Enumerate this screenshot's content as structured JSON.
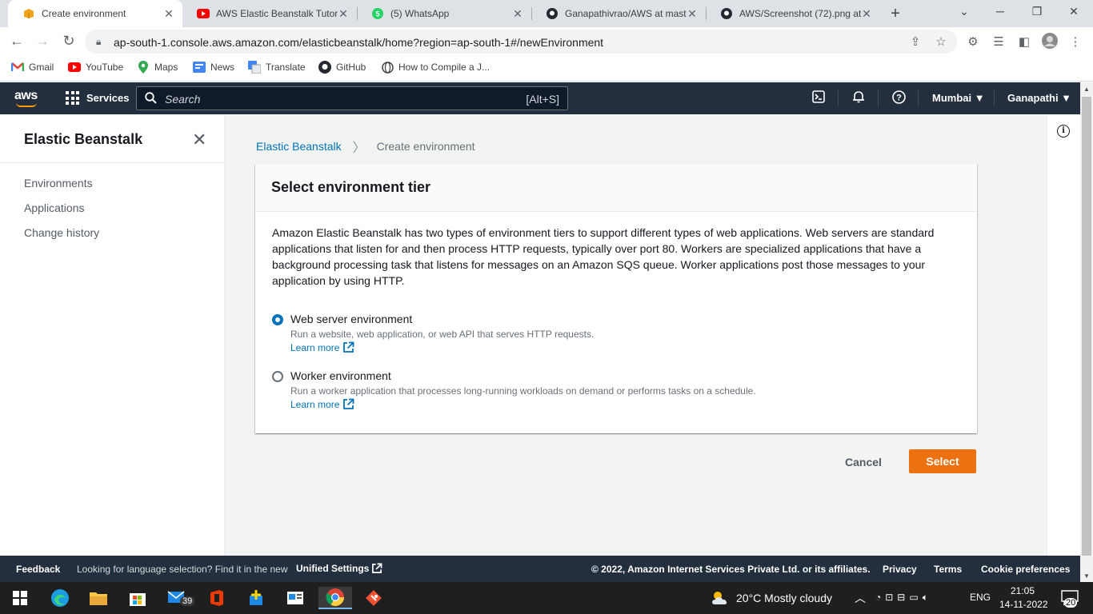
{
  "browser": {
    "tabs": [
      {
        "title": "Create environment",
        "icon": "aws-box-icon",
        "active": true
      },
      {
        "title": "AWS Elastic Beanstalk Tutoria",
        "icon": "youtube-icon"
      },
      {
        "title": "(5) WhatsApp",
        "icon": "whatsapp-icon"
      },
      {
        "title": "Ganapathivrao/AWS at maste",
        "icon": "github-icon"
      },
      {
        "title": "AWS/Screenshot (72).png at",
        "icon": "github-icon"
      }
    ],
    "url": "ap-south-1.console.aws.amazon.com/elasticbeanstalk/home?region=ap-south-1#/newEnvironment",
    "bookmarks": [
      {
        "label": "Gmail",
        "icon": "gmail-icon"
      },
      {
        "label": "YouTube",
        "icon": "youtube-icon"
      },
      {
        "label": "Maps",
        "icon": "maps-icon"
      },
      {
        "label": "News",
        "icon": "news-icon"
      },
      {
        "label": "Translate",
        "icon": "translate-icon"
      },
      {
        "label": "GitHub",
        "icon": "github-icon"
      },
      {
        "label": "How to Compile a J...",
        "icon": "globe-icon"
      }
    ]
  },
  "aws_header": {
    "logo": "aws",
    "services_label": "Services",
    "search_placeholder": "Search",
    "search_shortcut": "[Alt+S]",
    "region": "Mumbai ▼",
    "user": "Ganapathi ▼"
  },
  "sidebar": {
    "title": "Elastic Beanstalk",
    "items": [
      "Environments",
      "Applications",
      "Change history"
    ]
  },
  "breadcrumb": {
    "parent": "Elastic Beanstalk",
    "current": "Create environment"
  },
  "panel": {
    "title": "Select environment tier",
    "description": "Amazon Elastic Beanstalk has two types of environment tiers to support different types of web applications. Web servers are standard applications that listen for and then process HTTP requests, typically over port 80. Workers are specialized applications that have a background processing task that listens for messages on an Amazon SQS queue. Worker applications post those messages to your application by using HTTP.",
    "options": [
      {
        "label": "Web server environment",
        "description": "Run a website, web application, or web API that serves HTTP requests.",
        "link": "Learn more",
        "selected": true
      },
      {
        "label": "Worker environment",
        "description": "Run a worker application that processes long-running workloads on demand or performs tasks on a schedule.",
        "link": "Learn more",
        "selected": false
      }
    ]
  },
  "actions": {
    "cancel": "Cancel",
    "select": "Select"
  },
  "footer": {
    "feedback": "Feedback",
    "language_prefix": "Looking for language selection? Find it in the new",
    "language_link": "Unified Settings",
    "copyright": "© 2022, Amazon Internet Services Private Ltd. or its affiliates.",
    "privacy": "Privacy",
    "terms": "Terms",
    "cookies": "Cookie preferences"
  },
  "taskbar": {
    "mail_badge": "39",
    "weather": "20°C  Mostly cloudy",
    "language": "ENG",
    "time": "21:05",
    "date": "14-11-2022",
    "notifications": "20"
  },
  "colors": {
    "aws_dark": "#232f3e",
    "link": "#0073bb",
    "primary_button": "#ec7211"
  }
}
